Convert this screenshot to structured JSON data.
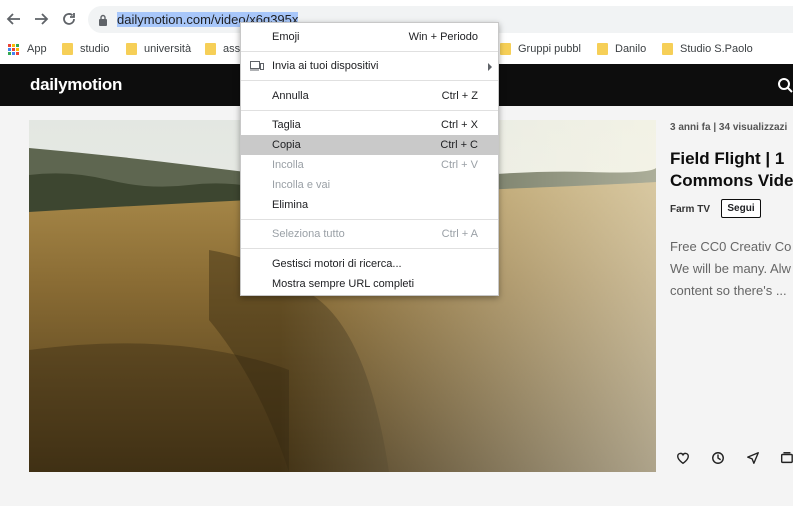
{
  "browser": {
    "url_selected": "dailymotion.com/video/x6q395x",
    "url_rest": ""
  },
  "bookmarks": [
    {
      "label": "App",
      "icon": "apps-grid-icon"
    },
    {
      "label": "studio",
      "icon": "folder-icon"
    },
    {
      "label": "università",
      "icon": "folder-icon"
    },
    {
      "label": "ass",
      "icon": "folder-icon"
    },
    {
      "label": "Gruppi pubbl",
      "icon": "folder-icon"
    },
    {
      "label": "Danilo",
      "icon": "folder-icon"
    },
    {
      "label": "Studio S.Paolo",
      "icon": "folder-icon"
    }
  ],
  "context_menu": {
    "items": [
      {
        "label": "Emoji",
        "shortcut": "Win + Periodo"
      },
      {
        "label": "Invia ai tuoi dispositivi",
        "shortcut": ""
      },
      {
        "label": "Annulla",
        "shortcut": "Ctrl + Z"
      },
      {
        "label": "Taglia",
        "shortcut": "Ctrl + X"
      },
      {
        "label": "Copia",
        "shortcut": "Ctrl + C"
      },
      {
        "label": "Incolla",
        "shortcut": "Ctrl + V"
      },
      {
        "label": "Incolla e vai",
        "shortcut": ""
      },
      {
        "label": "Elimina",
        "shortcut": ""
      },
      {
        "label": "Seleziona tutto",
        "shortcut": "Ctrl + A"
      },
      {
        "label": "Gestisci motori di ricerca...",
        "shortcut": ""
      },
      {
        "label": "Mostra sempre URL completi",
        "shortcut": ""
      }
    ]
  },
  "site": {
    "logo": "dailymotion",
    "meta": "3 anni fa  |  34 visualizzazi",
    "title_line1": "Field Flight | 1",
    "title_line2": "Commons Vide",
    "channel": "Farm TV",
    "follow_label": "Segui",
    "desc_line1": "Free CC0 Creativ Co",
    "desc_line2": "We will be many. Alw",
    "desc_line3": "content so there's ..."
  },
  "colors": {
    "selection": "#a8c7fa",
    "header_bg": "#0d0d0d",
    "menu_highlight": "#c9c9c9",
    "folder": "#f6cf57"
  }
}
